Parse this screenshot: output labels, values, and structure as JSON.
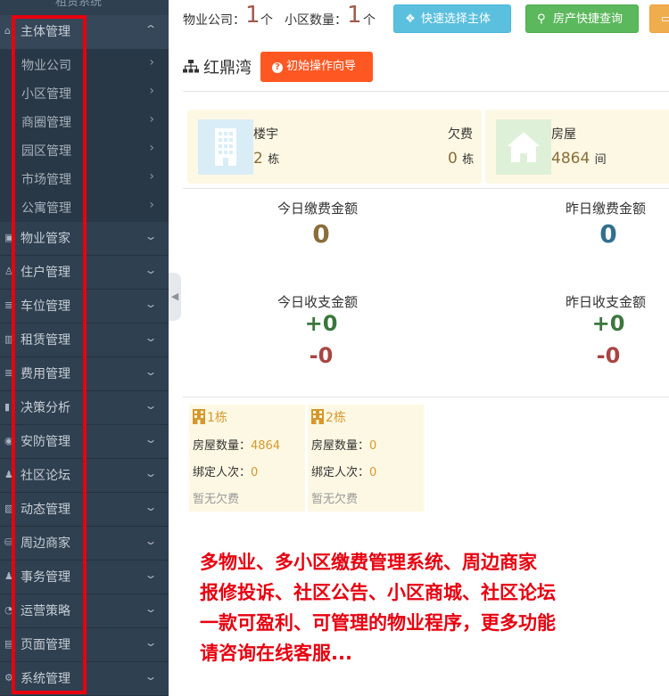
{
  "sidebar": {
    "top_label": "租赁系统",
    "menu": [
      {
        "label": "主体管理",
        "icon": "home-icon",
        "glyph": "⌂",
        "open": true,
        "children": [
          "物业公司",
          "小区管理",
          "商圈管理",
          "园区管理",
          "市场管理",
          "公寓管理"
        ]
      },
      {
        "label": "物业管家",
        "icon": "book-icon",
        "glyph": "▣"
      },
      {
        "label": "住户管理",
        "icon": "user-icon",
        "glyph": "♙"
      },
      {
        "label": "车位管理",
        "icon": "list-icon",
        "glyph": "≣"
      },
      {
        "label": "租赁管理",
        "icon": "building-icon",
        "glyph": "▥"
      },
      {
        "label": "费用管理",
        "icon": "list-icon",
        "glyph": "≣"
      },
      {
        "label": "决策分析",
        "icon": "bar-chart-icon",
        "glyph": "▮"
      },
      {
        "label": "安防管理",
        "icon": "eye-icon",
        "glyph": "◉"
      },
      {
        "label": "社区论坛",
        "icon": "user-icon",
        "glyph": "♟"
      },
      {
        "label": "动态管理",
        "icon": "picture-icon",
        "glyph": "▧"
      },
      {
        "label": "周边商家",
        "icon": "database-icon",
        "glyph": "⛁"
      },
      {
        "label": "事务管理",
        "icon": "person-icon",
        "glyph": "♟"
      },
      {
        "label": "运营策略",
        "icon": "pie-chart-icon",
        "glyph": "◔"
      },
      {
        "label": "页面管理",
        "icon": "window-icon",
        "glyph": "▤"
      },
      {
        "label": "系统管理",
        "icon": "gear-icon",
        "glyph": "⚙"
      }
    ]
  },
  "header": {
    "company_label": "物业公司：",
    "company_count": "1",
    "company_unit": "个",
    "community_label": "小区数量：",
    "community_count": "1",
    "community_unit": "个",
    "quick_select_label": "快速选择主体",
    "house_query_label": "房产快捷查询"
  },
  "page": {
    "title": "红鼎湾",
    "guide_button": "初始操作向导"
  },
  "cards": {
    "building_label": "楼宇",
    "building_value": "2",
    "building_unit": "栋",
    "arrears_label": "欠费",
    "arrears_value": "0",
    "arrears_unit": "栋",
    "house_label": "房屋",
    "house_value": "4864",
    "house_unit": "间"
  },
  "amounts": {
    "today_pay_label": "今日缴费金额",
    "today_pay_value": "0",
    "yesterday_pay_label": "昨日缴费金额",
    "yesterday_pay_value": "0",
    "today_balance_label": "今日收支金额",
    "today_income": "+0",
    "today_expense": "-0",
    "yesterday_balance_label": "昨日收支金额",
    "yesterday_income": "+0",
    "yesterday_expense": "-0"
  },
  "buildings": [
    {
      "name": "1栋",
      "house_label": "房屋数量：",
      "house_value": "4864",
      "bind_label": "绑定人次：",
      "bind_value": "0",
      "note": "暂无欠费"
    },
    {
      "name": "2栋",
      "house_label": "房屋数量：",
      "house_value": "0",
      "bind_label": "绑定人次：",
      "bind_value": "0",
      "note": "暂无欠费"
    }
  ],
  "promo": [
    "多物业、多小区缴费管理系统、周边商家",
    "报修投诉、社区公告、小区商城、社区论坛",
    "一款可盈利、可管理的物业程序，更多功能",
    "请咨询在线客服..."
  ],
  "colors": {
    "sidebar_bg": "#2f4050",
    "highlight_red": "#e8000f",
    "btn_blue": "#5bc0de",
    "btn_green": "#5cb85c",
    "btn_orange": "#f0ad4e",
    "guide_orange": "#ff5722",
    "income_green": "#3c763d",
    "expense_red": "#a94442"
  }
}
